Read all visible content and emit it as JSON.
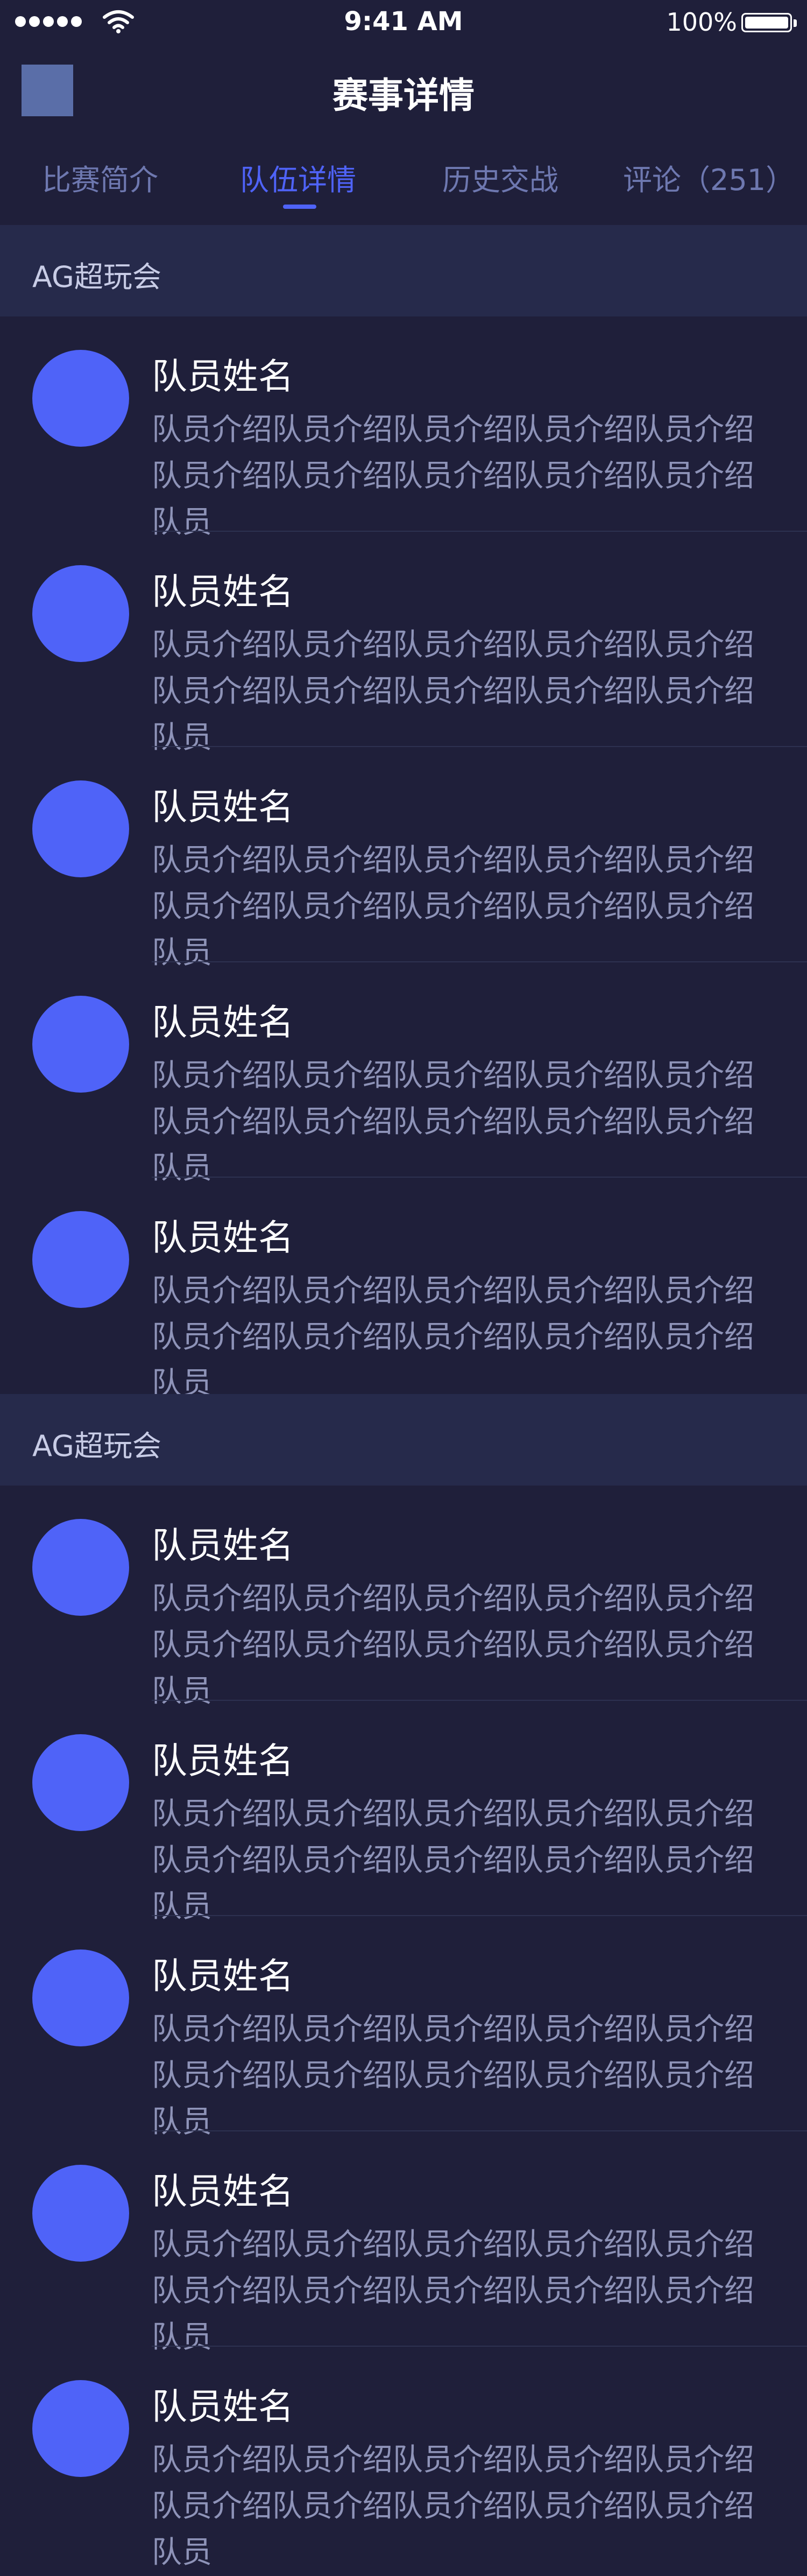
{
  "status_bar": {
    "time": "9:41 AM",
    "battery_percent": "100%",
    "signal_dots": 5,
    "icons": [
      "signal-icon",
      "wifi-icon",
      "battery-icon"
    ]
  },
  "header": {
    "title": "赛事详情"
  },
  "tabs": [
    {
      "label": "比赛简介",
      "active": false
    },
    {
      "label": "队伍详情",
      "active": true
    },
    {
      "label": "历史交战",
      "active": false
    },
    {
      "label": "评论（251）",
      "active": false
    }
  ],
  "teams": [
    {
      "name": "AG超玩会",
      "members": [
        {
          "name": "队员姓名",
          "desc": "队员介绍队员介绍队员介绍队员介绍队员介绍队员介绍队员介绍队员介绍队员介绍队员介绍队员"
        },
        {
          "name": "队员姓名",
          "desc": "队员介绍队员介绍队员介绍队员介绍队员介绍队员介绍队员介绍队员介绍队员介绍队员介绍队员"
        },
        {
          "name": "队员姓名",
          "desc": "队员介绍队员介绍队员介绍队员介绍队员介绍队员介绍队员介绍队员介绍队员介绍队员介绍队员"
        },
        {
          "name": "队员姓名",
          "desc": "队员介绍队员介绍队员介绍队员介绍队员介绍队员介绍队员介绍队员介绍队员介绍队员介绍队员"
        },
        {
          "name": "队员姓名",
          "desc": "队员介绍队员介绍队员介绍队员介绍队员介绍队员介绍队员介绍队员介绍队员介绍队员介绍队员"
        }
      ]
    },
    {
      "name": "AG超玩会",
      "members": [
        {
          "name": "队员姓名",
          "desc": "队员介绍队员介绍队员介绍队员介绍队员介绍队员介绍队员介绍队员介绍队员介绍队员介绍队员"
        },
        {
          "name": "队员姓名",
          "desc": "队员介绍队员介绍队员介绍队员介绍队员介绍队员介绍队员介绍队员介绍队员介绍队员介绍队员"
        },
        {
          "name": "队员姓名",
          "desc": "队员介绍队员介绍队员介绍队员介绍队员介绍队员介绍队员介绍队员介绍队员介绍队员介绍队员"
        },
        {
          "name": "队员姓名",
          "desc": "队员介绍队员介绍队员介绍队员介绍队员介绍队员介绍队员介绍队员介绍队员介绍队员介绍队员"
        },
        {
          "name": "队员姓名",
          "desc": "队员介绍队员介绍队员介绍队员介绍队员介绍队员介绍队员介绍队员介绍队员介绍队员介绍队员"
        }
      ]
    }
  ],
  "colors": {
    "background": "#1f1f3a",
    "section_header": "#262a4b",
    "accent": "#4f63f8",
    "tab_inactive": "#6e78b0",
    "description_text": "#8e93b8"
  }
}
